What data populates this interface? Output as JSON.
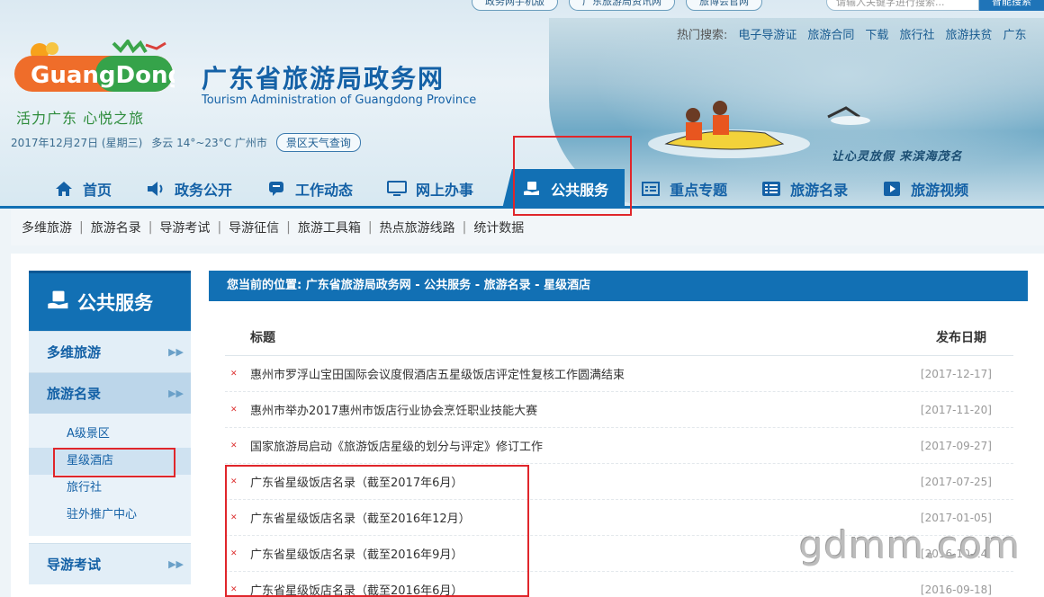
{
  "top_links": [
    "政务网手机版",
    "广东旅游局资讯网",
    "旅博会官网"
  ],
  "search": {
    "placeholder": "请输入关键字进行搜索...",
    "button": "智能搜索"
  },
  "hot_search": {
    "label": "热门搜索:",
    "items": [
      "电子导游证",
      "旅游合同",
      "下载",
      "旅行社",
      "旅游扶贫",
      "广东"
    ]
  },
  "logo": {
    "text": "GuangDong",
    "slogan": "活力广东  心悦之旅"
  },
  "site": {
    "title": "广东省旅游局政务网",
    "subtitle": "Tourism Administration of Guangdong Province"
  },
  "weather": {
    "date": "2017年12月27日 (星期三)",
    "condition": "多云 14°~23°C 广州市",
    "button": "景区天气查询"
  },
  "motto": "让心灵放假  来滨海茂名",
  "nav": [
    {
      "label": "首页",
      "icon": "home-icon"
    },
    {
      "label": "政务公开",
      "icon": "speaker-icon"
    },
    {
      "label": "工作动态",
      "icon": "chat-icon"
    },
    {
      "label": "网上办事",
      "icon": "monitor-icon"
    },
    {
      "label": "公共服务",
      "icon": "service-icon",
      "active": true
    },
    {
      "label": "重点专题",
      "icon": "list-icon"
    },
    {
      "label": "旅游名录",
      "icon": "catalog-icon"
    },
    {
      "label": "旅游视频",
      "icon": "video-icon"
    }
  ],
  "subnav": [
    "多维旅游",
    "旅游名录",
    "导游考试",
    "导游征信",
    "旅游工具箱",
    "热点旅游线路",
    "统计数据"
  ],
  "sidebar": {
    "header": "公共服务",
    "items": [
      {
        "label": "多维旅游"
      },
      {
        "label": "旅游名录",
        "active": true
      },
      {
        "label": "导游考试"
      }
    ],
    "subs": [
      "A级景区",
      "星级酒店",
      "旅行社",
      "驻外推广中心"
    ]
  },
  "breadcrumb": "您当前的位置: 广东省旅游局政务网 - 公共服务 - 旅游名录 - 星级酒店",
  "list": {
    "col_title": "标题",
    "col_date": "发布日期",
    "rows": [
      {
        "title": "惠州市罗浮山宝田国际会议度假酒店五星级饭店评定性复核工作圆满结束",
        "date": "[2017-12-17]"
      },
      {
        "title": "惠州市举办2017惠州市饭店行业协会烹饪职业技能大赛",
        "date": "[2017-11-20]"
      },
      {
        "title": "国家旅游局启动《旅游饭店星级的划分与评定》修订工作",
        "date": "[2017-09-27]"
      },
      {
        "title": "广东省星级饭店名录（截至2017年6月）",
        "date": "[2017-07-25]"
      },
      {
        "title": "广东省星级饭店名录（截至2016年12月）",
        "date": "[2017-01-05]"
      },
      {
        "title": "广东省星级饭店名录（截至2016年9月）",
        "date": "[2016-10-14]"
      },
      {
        "title": "广东省星级饭店名录（截至2016年6月）",
        "date": "[2016-09-18]"
      }
    ]
  },
  "watermark": "gdmm.com"
}
